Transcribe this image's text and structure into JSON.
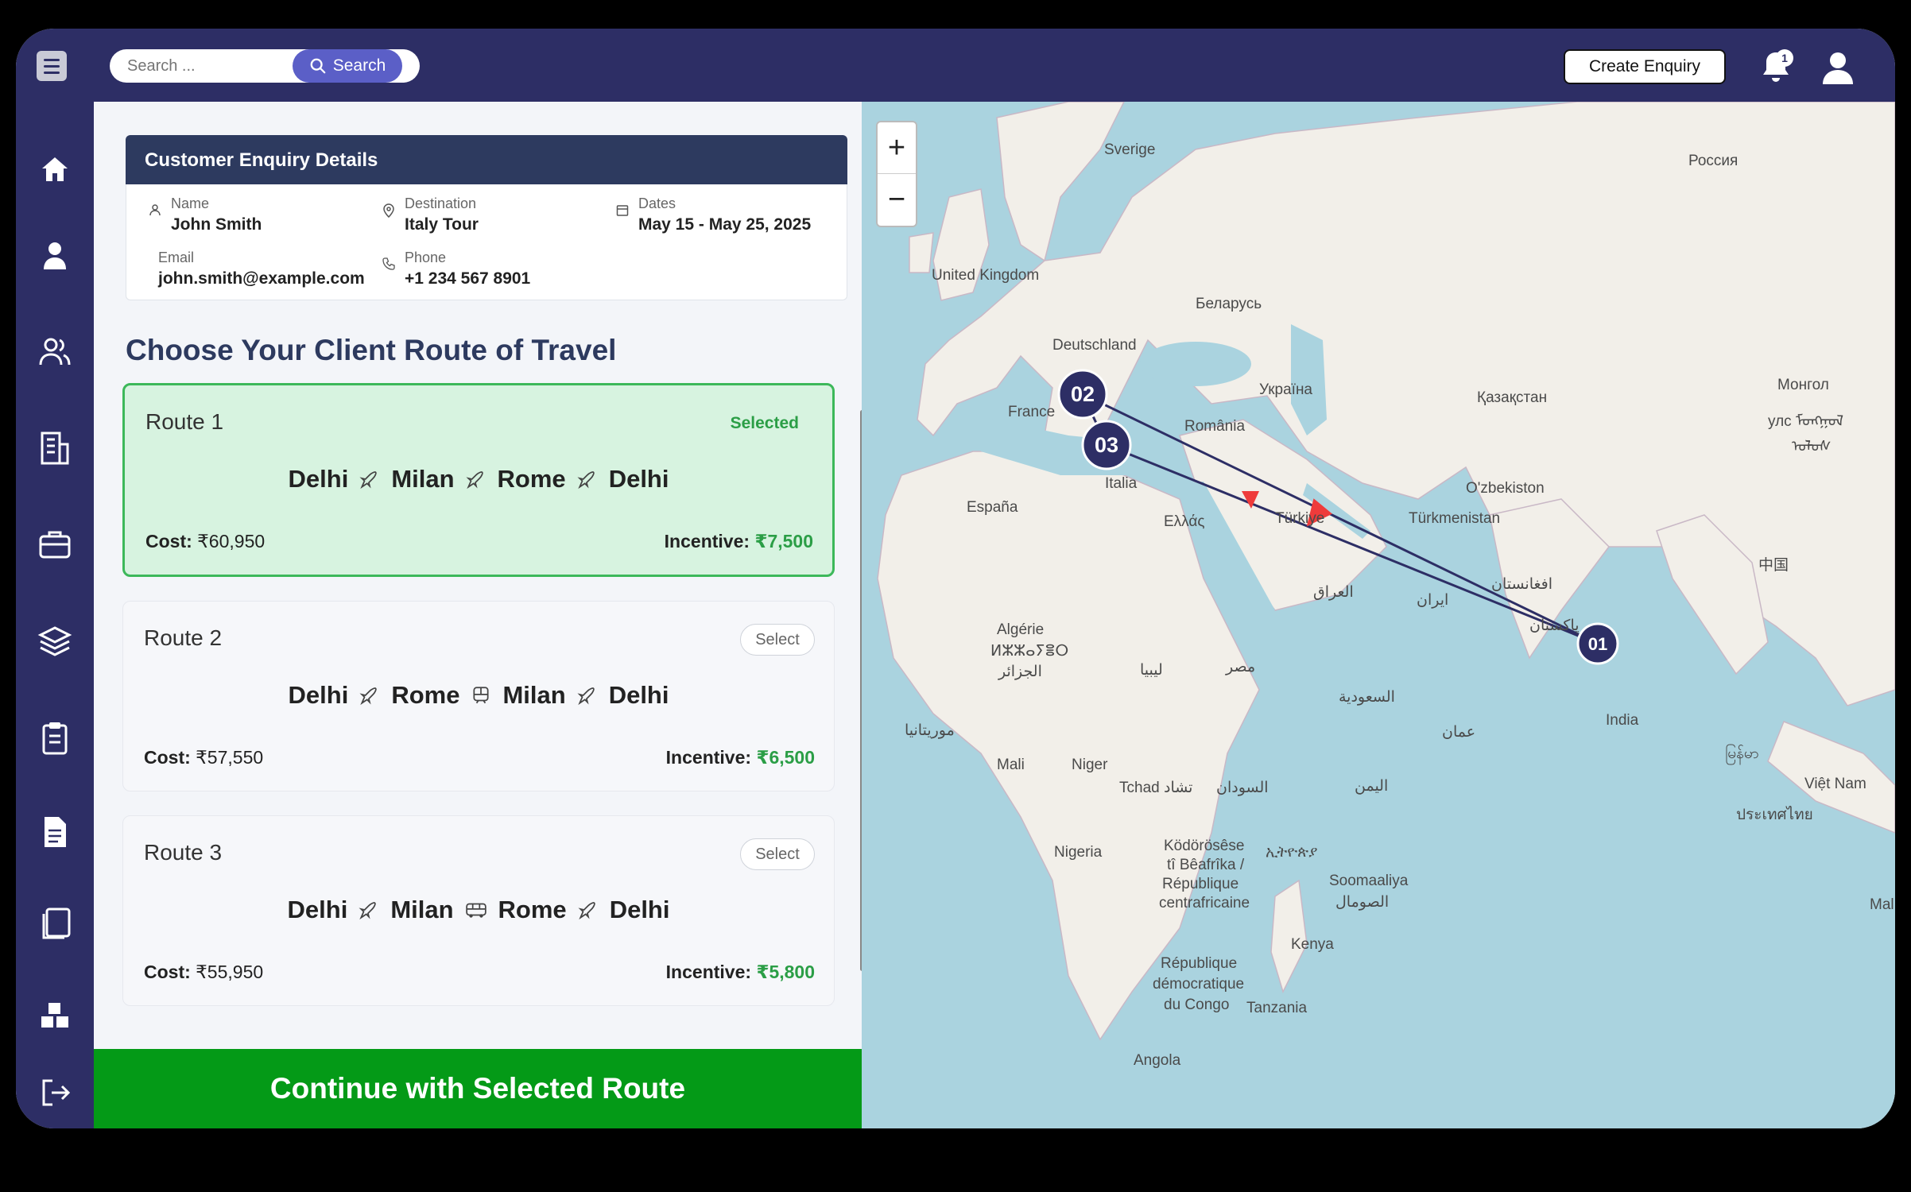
{
  "topbar": {
    "search_placeholder": "Search ...",
    "search_label": "Search",
    "create_enquiry_label": "Create Enquiry",
    "notification_count": "1"
  },
  "sidebar": {
    "items": [
      {
        "icon": "home-icon"
      },
      {
        "icon": "user-icon"
      },
      {
        "icon": "users-icon"
      },
      {
        "icon": "building-icon"
      },
      {
        "icon": "briefcase-icon"
      },
      {
        "icon": "layers-icon"
      },
      {
        "icon": "clipboard-icon"
      },
      {
        "icon": "document-icon"
      },
      {
        "icon": "copy-icon"
      },
      {
        "icon": "boxes-icon"
      },
      {
        "icon": "logout-icon"
      }
    ]
  },
  "enquiry": {
    "title": "Customer Enquiry Details",
    "name_label": "Name",
    "name": "John Smith",
    "destination_label": "Destination",
    "destination": "Italy Tour",
    "dates_label": "Dates",
    "dates": "May 15 - May 25, 2025",
    "email_label": "Email",
    "email": "john.smith@example.com",
    "phone_label": "Phone",
    "phone": "+1 234 567 8901"
  },
  "routes_heading": "Choose Your Client Route of Travel",
  "routes": [
    {
      "name": "Route 1",
      "status": "Selected",
      "stops": [
        "Delhi",
        "Milan",
        "Rome",
        "Delhi"
      ],
      "modes": [
        "flight",
        "flight",
        "flight"
      ],
      "cost_label": "Cost:",
      "cost": "₹60,950",
      "incentive_label": "Incentive:",
      "incentive": "₹7,500"
    },
    {
      "name": "Route 2",
      "status": "Select",
      "stops": [
        "Delhi",
        "Rome",
        "Milan",
        "Delhi"
      ],
      "modes": [
        "flight",
        "train",
        "flight"
      ],
      "cost_label": "Cost:",
      "cost": "₹57,550",
      "incentive_label": "Incentive:",
      "incentive": "₹6,500"
    },
    {
      "name": "Route 3",
      "status": "Select",
      "stops": [
        "Delhi",
        "Milan",
        "Rome",
        "Delhi"
      ],
      "modes": [
        "flight",
        "bus",
        "flight"
      ],
      "cost_label": "Cost:",
      "cost": "₹55,950",
      "incentive_label": "Incentive:",
      "incentive": "₹5,800"
    }
  ],
  "continue_label": "Continue with Selected Route",
  "map": {
    "zoom_in": "+",
    "zoom_out": "−",
    "markers": [
      "01",
      "02",
      "03"
    ],
    "labels": [
      "Sverige",
      "Россия",
      "United Kingdom",
      "Беларусь",
      "Deutschland",
      "Україна",
      "Қазақстан",
      "Монгол",
      "улс ᠮᠤᠩᠭᠤᠯ",
      "ᠤᠯᠤᠰ",
      "France",
      "România",
      "España",
      "Italia",
      "Ελλάς",
      "Türkiye",
      "O'zbekiston",
      "Türkmenistan",
      "中国",
      "افغانستان",
      "پاکستان",
      "ایران",
      "العراق",
      "Algérie",
      "ⵍⵣⵣⴰⵢⴻⵔ",
      "الجزائر",
      "ليبيا",
      "مصر",
      "السعودية",
      "عمان",
      "India",
      "موريتانيا",
      "Mali",
      "Niger",
      "Tchad تشاد",
      "السودان",
      "اليمن",
      "မြန်မာ",
      "Việt Nam",
      "ประเทศไทย",
      "Nigeria",
      "Ködörösêse",
      "tî Bêafrîka /",
      "République",
      "centrafricaine",
      "ኢትዮጵያ",
      "Soomaaliya",
      "الصومال",
      "Kenya",
      "République",
      "démocratique",
      "du Congo",
      "Tanzania",
      "Angola",
      "Mal"
    ]
  }
}
